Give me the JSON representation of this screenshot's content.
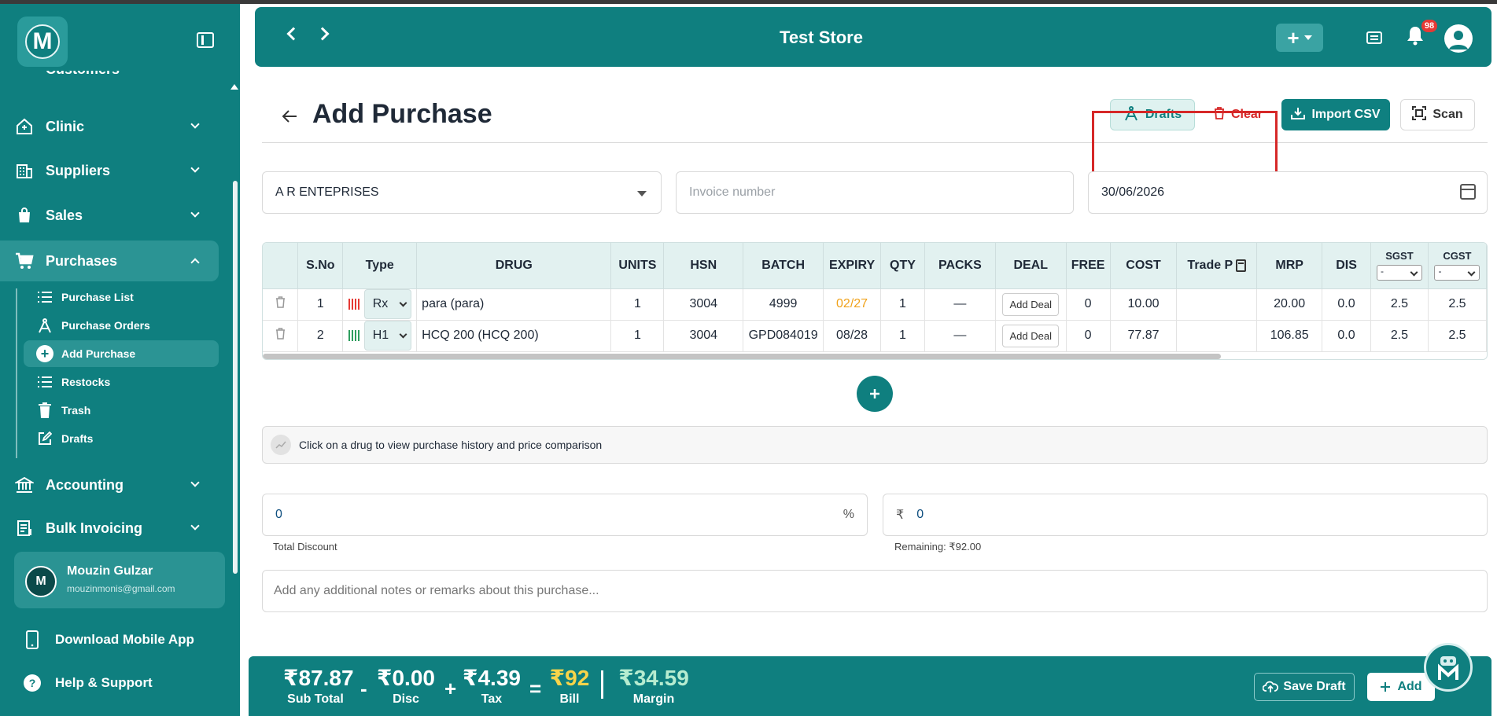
{
  "sidebar": {
    "logo_letter": "M",
    "partial_item": "Customers",
    "items": [
      {
        "label": "Clinic",
        "icon": "clinic-icon"
      },
      {
        "label": "Suppliers",
        "icon": "building-icon"
      },
      {
        "label": "Sales",
        "icon": "shopping-bag-icon"
      },
      {
        "label": "Purchases",
        "icon": "cart-icon"
      },
      {
        "label": "Accounting",
        "icon": "bank-icon"
      },
      {
        "label": "Bulk Invoicing",
        "icon": "invoice-icon"
      }
    ],
    "sub_items": [
      {
        "label": "Purchase List",
        "icon": "list-icon"
      },
      {
        "label": "Purchase Orders",
        "icon": "compass-icon"
      },
      {
        "label": "Add Purchase",
        "icon": "plus-circle-icon"
      },
      {
        "label": "Restocks",
        "icon": "list-icon"
      },
      {
        "label": "Trash",
        "icon": "trash-icon"
      },
      {
        "label": "Drafts",
        "icon": "edit-icon"
      }
    ],
    "user": {
      "initial": "M",
      "name": "Mouzin Gulzar",
      "email": "mouzinmonis@gmail.com"
    },
    "download_app": "Download Mobile App",
    "help": "Help & Support"
  },
  "header": {
    "title": "Test Store",
    "plus": "+",
    "notification_count": "98"
  },
  "page": {
    "title": "Add Purchase",
    "buttons": {
      "drafts": "Drafts",
      "clear": "Clear",
      "import_csv": "Import CSV",
      "scan": "Scan"
    },
    "supplier": "A R ENTEPRISES",
    "invoice_placeholder": "Invoice number",
    "date": "30/06/2026"
  },
  "table": {
    "columns": [
      "S.No",
      "Type",
      "DRUG",
      "UNITS",
      "HSN",
      "BATCH",
      "EXPIRY",
      "QTY",
      "PACKS",
      "DEAL",
      "FREE",
      "COST",
      "Trade P",
      "MRP",
      "DIS",
      "SGST",
      "CGST"
    ],
    "tax_select_value": "-",
    "add_deal_label": "Add Deal",
    "rows": [
      {
        "sno": "1",
        "type": "Rx",
        "drug": "para (para)",
        "units": "1",
        "hsn": "3004",
        "batch": "4999",
        "expiry": "02/27",
        "qty": "1",
        "packs": "—",
        "free": "0",
        "cost": "10.00",
        "trade": "",
        "mrp": "20.00",
        "dis": "0.0",
        "sgst": "2.5",
        "cgst": "2.5"
      },
      {
        "sno": "2",
        "type": "H1",
        "drug": "HCQ 200 (HCQ 200)",
        "units": "1",
        "hsn": "3004",
        "batch": "GPD084019",
        "expiry": "08/28",
        "qty": "1",
        "packs": "—",
        "free": "0",
        "cost": "77.87",
        "trade": "",
        "mrp": "106.85",
        "dis": "0.0",
        "sgst": "2.5",
        "cgst": "2.5"
      }
    ]
  },
  "history_hint": "Click on a drug to view purchase history and price comparison",
  "discount": {
    "value": "0",
    "unit": "%",
    "label": "Total Discount"
  },
  "remaining": {
    "currency": "₹",
    "value": "0",
    "label": "Remaining: ₹92.00"
  },
  "notes_placeholder": "Add any additional notes or remarks about this purchase...",
  "footer": {
    "subtotal": {
      "value": "₹87.87",
      "label": "Sub Total"
    },
    "disc": {
      "value": "₹0.00",
      "label": "Disc"
    },
    "tax": {
      "value": "₹4.39",
      "label": "Tax"
    },
    "bill": {
      "value": "₹92",
      "label": "Bill"
    },
    "margin": {
      "value": "₹34.59",
      "label": "Margin"
    },
    "op_minus": "-",
    "op_plus": "+",
    "op_eq": "=",
    "save_draft": "Save Draft",
    "add": "Add"
  },
  "colors": {
    "primary": "#0f7f7f",
    "danger": "#d62828",
    "warning": "#f0a21a",
    "bill": "#f7d44a"
  }
}
